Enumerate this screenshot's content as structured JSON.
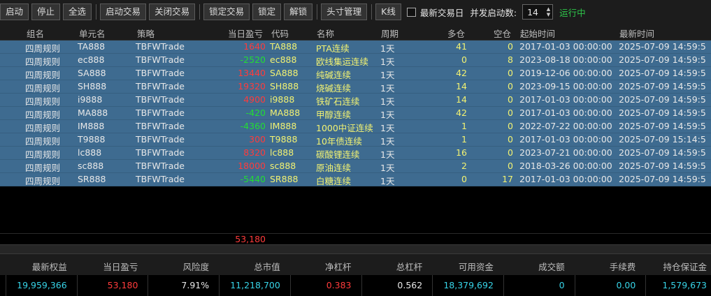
{
  "toolbar": {
    "buttons": [
      "启动",
      "停止",
      "全选",
      "启动交易",
      "关闭交易",
      "锁定交易",
      "锁定",
      "解锁",
      "头寸管理",
      "K线"
    ],
    "latest_trade_day_label": "最新交易日",
    "concurrency_label": "并发启动数:",
    "concurrency_value": "14",
    "status": "运行中"
  },
  "grid": {
    "columns": [
      "组名",
      "单元名",
      "策略",
      "当日盈亏",
      "代码",
      "名称",
      "周期",
      "多仓",
      "空仓",
      "起始时间",
      "最新时间"
    ],
    "rows": [
      {
        "group": "四周规则",
        "unit": "TA888",
        "strategy": "TBFWTrade",
        "pnl": "1640",
        "code": "TA888",
        "name": "PTA连续",
        "period": "1天",
        "long": "41",
        "short": "0",
        "start": "2017-01-03 00:00:00",
        "last": "2025-07-09 14:59:5"
      },
      {
        "group": "四周规则",
        "unit": "ec888",
        "strategy": "TBFWTrade",
        "pnl": "-2520",
        "code": "ec888",
        "name": "欧线集运连续",
        "period": "1天",
        "long": "0",
        "short": "8",
        "start": "2023-08-18 00:00:00",
        "last": "2025-07-09 14:59:5"
      },
      {
        "group": "四周规则",
        "unit": "SA888",
        "strategy": "TBFWTrade",
        "pnl": "13440",
        "code": "SA888",
        "name": "纯碱连续",
        "period": "1天",
        "long": "42",
        "short": "0",
        "start": "2019-12-06 00:00:00",
        "last": "2025-07-09 14:59:5"
      },
      {
        "group": "四周规则",
        "unit": "SH888",
        "strategy": "TBFWTrade",
        "pnl": "19320",
        "code": "SH888",
        "name": "烧碱连续",
        "period": "1天",
        "long": "14",
        "short": "0",
        "start": "2023-09-15 00:00:00",
        "last": "2025-07-09 14:59:5"
      },
      {
        "group": "四周规则",
        "unit": "i9888",
        "strategy": "TBFWTrade",
        "pnl": "4900",
        "code": "i9888",
        "name": "铁矿石连续",
        "period": "1天",
        "long": "14",
        "short": "0",
        "start": "2017-01-03 00:00:00",
        "last": "2025-07-09 14:59:5"
      },
      {
        "group": "四周规则",
        "unit": "MA888",
        "strategy": "TBFWTrade",
        "pnl": "-420",
        "code": "MA888",
        "name": "甲醇连续",
        "period": "1天",
        "long": "42",
        "short": "0",
        "start": "2017-01-03 00:00:00",
        "last": "2025-07-09 14:59:5"
      },
      {
        "group": "四周规则",
        "unit": "IM888",
        "strategy": "TBFWTrade",
        "pnl": "-4360",
        "code": "IM888",
        "name": "1000中证连续",
        "period": "1天",
        "long": "1",
        "short": "0",
        "start": "2022-07-22 00:00:00",
        "last": "2025-07-09 14:59:5"
      },
      {
        "group": "四周规则",
        "unit": "T9888",
        "strategy": "TBFWTrade",
        "pnl": "300",
        "code": "T9888",
        "name": "10年债连续",
        "period": "1天",
        "long": "1",
        "short": "0",
        "start": "2017-01-03 00:00:00",
        "last": "2025-07-09 15:14:5"
      },
      {
        "group": "四周规则",
        "unit": "lc888",
        "strategy": "TBFWTrade",
        "pnl": "8320",
        "code": "lc888",
        "name": "碳酸锂连续",
        "period": "1天",
        "long": "16",
        "short": "0",
        "start": "2023-07-21 00:00:00",
        "last": "2025-07-09 14:59:5"
      },
      {
        "group": "四周规则",
        "unit": "sc888",
        "strategy": "TBFWTrade",
        "pnl": "18000",
        "code": "sc888",
        "name": "原油连续",
        "period": "1天",
        "long": "2",
        "short": "0",
        "start": "2018-03-26 00:00:00",
        "last": "2025-07-09 14:59:5"
      },
      {
        "group": "四周规则",
        "unit": "SR888",
        "strategy": "TBFWTrade",
        "pnl": "-5440",
        "code": "SR888",
        "name": "白糖连续",
        "period": "1天",
        "long": "0",
        "short": "17",
        "start": "2017-01-03 00:00:00",
        "last": "2025-07-09 14:59:5"
      }
    ],
    "total_pnl": "53,180"
  },
  "summary": {
    "labels": [
      "最新权益",
      "当日盈亏",
      "风险度",
      "总市值",
      "净杠杆",
      "总杠杆",
      "可用资金",
      "成交额",
      "手续费",
      "持仓保证金"
    ],
    "values": [
      "19,959,366",
      "53,180",
      "7.91%",
      "11,218,700",
      "0.383",
      "0.562",
      "18,379,692",
      "0",
      "0.00",
      "1,579,673"
    ],
    "value_colors": [
      "cyan",
      "red",
      "white",
      "cyan",
      "red",
      "white",
      "cyan",
      "cyan",
      "cyan",
      "cyan"
    ]
  },
  "colors": {
    "row_selected": "#3e6b90",
    "positive": "#ff3b3b",
    "negative": "#22dd33",
    "highlight_text": "#f2f272",
    "status_running": "#2ec84a",
    "cyan": "#37d4e8"
  }
}
